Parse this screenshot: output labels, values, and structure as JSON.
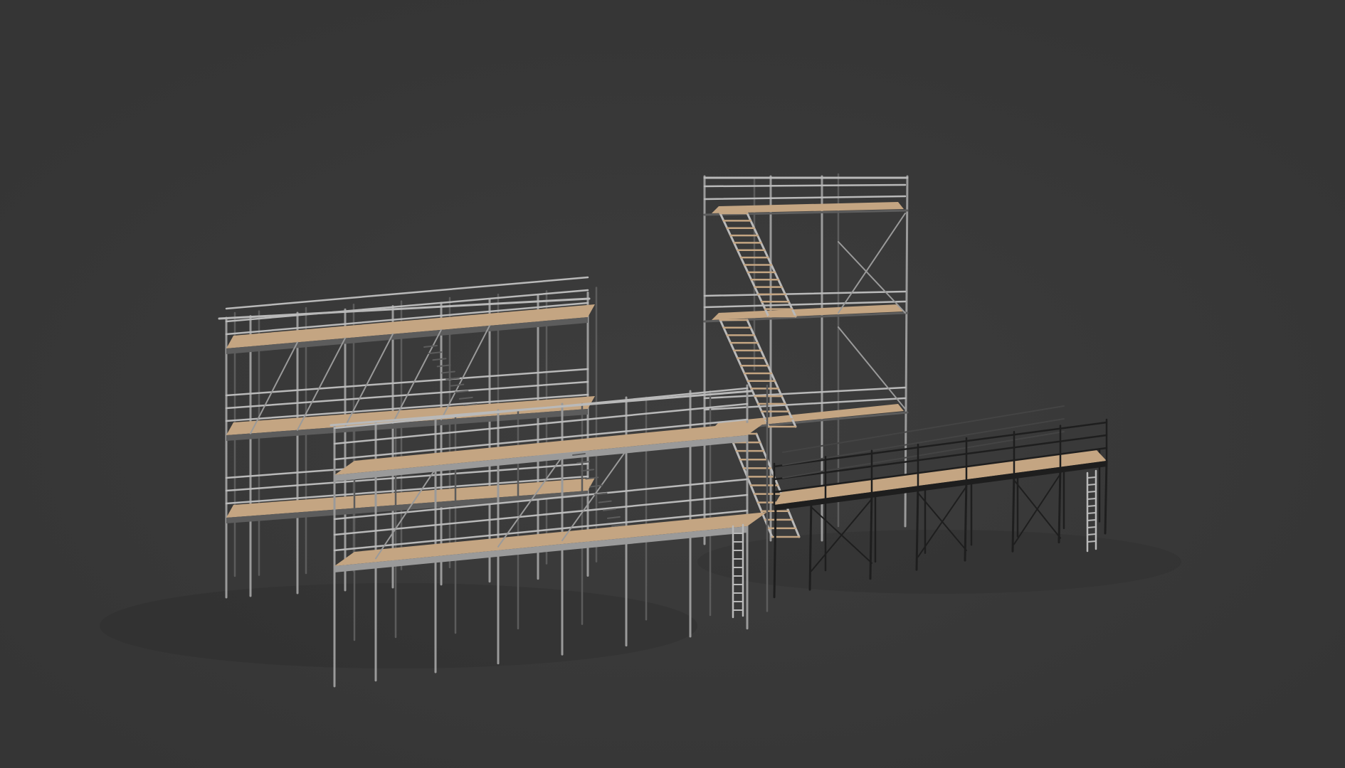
{
  "scene": {
    "subject": "scaffolding-render",
    "colors": {
      "background": "#383838",
      "background_glow": "#3c3c3c",
      "steel": "#9a9a9a",
      "steel_light": "#b9b9b9",
      "steel_dark": "#5c5c5c",
      "plank": "#c4a582",
      "plank_shadow": "#8f7760",
      "platform_frame": "#1e1e1e",
      "shadow": "#2c2c2c"
    },
    "objects": [
      {
        "name": "scaffold-left-tall",
        "levels": 3
      },
      {
        "name": "scaffold-front",
        "levels": 2
      },
      {
        "name": "stair-tower",
        "levels": 3
      },
      {
        "name": "platform-walkway",
        "levels": 1
      }
    ]
  }
}
